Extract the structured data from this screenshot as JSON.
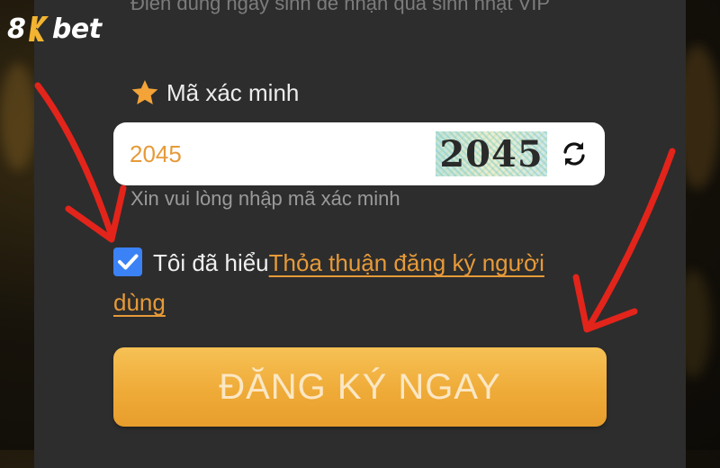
{
  "brand": {
    "logo_eight": "8",
    "logo_rest": "bet"
  },
  "top_note": "Điền đúng ngày sinh để nhận quà sinh nhật VIP",
  "verification": {
    "label": "Mã xác minh",
    "input_value": "2045",
    "captcha_text": "2045",
    "hint": "Xin vui lòng nhập mã xác minh"
  },
  "agreement": {
    "checked": true,
    "text": "Tôi đã hiểu",
    "link": "Thỏa thuận đăng ký người dùng"
  },
  "register_button": "ĐĂNG KÝ NGAY",
  "colors": {
    "accent": "#e69a39",
    "button": "#efab38",
    "checkbox": "#3b82f6",
    "annotation_arrow": "#e3241b"
  },
  "icons": [
    "star-icon",
    "refresh-icon",
    "check-icon",
    "arrow-annotation"
  ]
}
